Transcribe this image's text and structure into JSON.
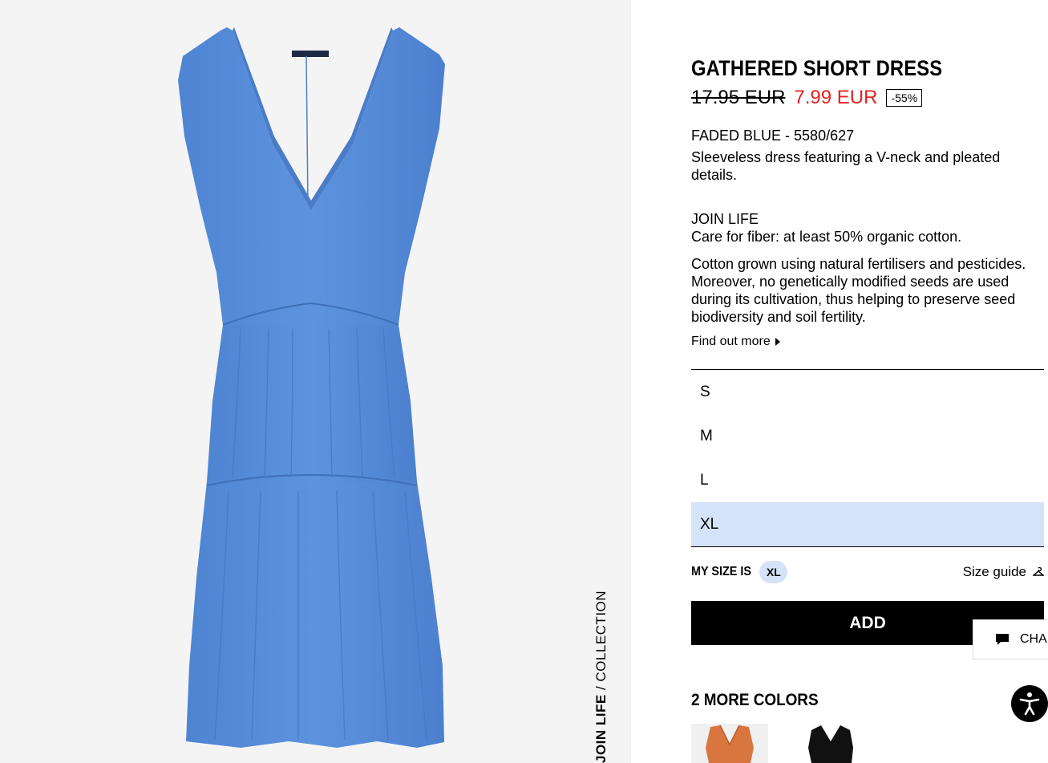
{
  "collection_label": {
    "bold": "JOIN LIFE",
    "rest": " / COLLECTION"
  },
  "product": {
    "title": "GATHERED SHORT DRESS",
    "old_price": "17.95 EUR",
    "new_price": "7.99 EUR",
    "discount": "-55%",
    "color_ref": "FADED BLUE - 5580/627",
    "description": "Sleeveless dress featuring a V-neck and pleated details."
  },
  "join_life": {
    "title": "JOIN LIFE",
    "subtitle": "Care for fiber: at least 50% organic cotton.",
    "text": "Cotton grown using natural fertilisers and pesticides. Moreover, no genetically modified seeds are used during its cultivation, thus helping to preserve seed biodiversity and soil fertility.",
    "link": "Find out more"
  },
  "sizes": [
    {
      "label": "S",
      "selected": false
    },
    {
      "label": "M",
      "selected": false
    },
    {
      "label": "L",
      "selected": false
    },
    {
      "label": "XL",
      "selected": true
    }
  ],
  "my_size": {
    "label": "MY SIZE IS",
    "value": "XL"
  },
  "size_guide": "Size guide",
  "add_button": "ADD",
  "more_colors": {
    "title": "2 MORE COLORS",
    "swatches": [
      "orange",
      "black"
    ]
  },
  "chat": {
    "label": "CHA"
  },
  "colors": {
    "dress": "#5a8fd9",
    "sale": "#e62020",
    "selected_size": "#d4e3f7",
    "swatch_orange": "#d9763f",
    "swatch_black": "#111111"
  },
  "icons": [
    "chat-bubble-icon",
    "hanger-icon",
    "accessibility-icon",
    "caret-right-icon"
  ]
}
